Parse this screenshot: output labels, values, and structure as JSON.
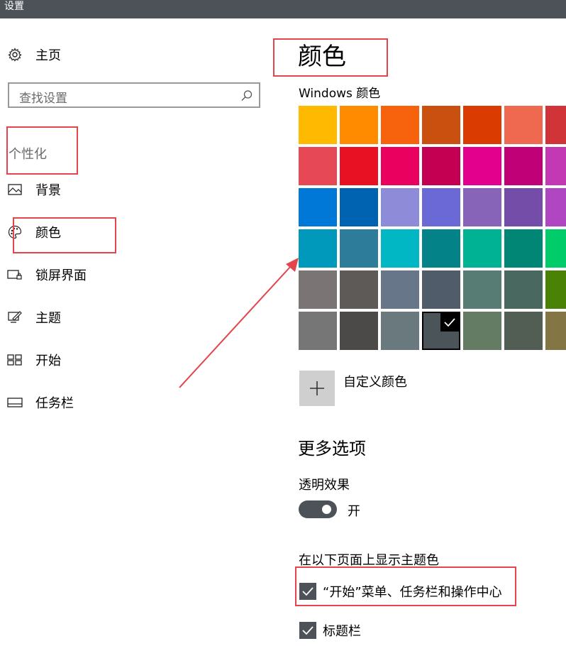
{
  "window": {
    "title": "设置"
  },
  "sidebar": {
    "home": {
      "label": "主页",
      "icon": "gear-icon"
    },
    "search": {
      "placeholder": "查找设置",
      "icon": "search-icon"
    },
    "category": "个性化",
    "items": [
      {
        "label": "背景",
        "icon": "picture-icon"
      },
      {
        "label": "颜色",
        "icon": "palette-icon"
      },
      {
        "label": "锁屏界面",
        "icon": "lock-screen-icon"
      },
      {
        "label": "主题",
        "icon": "theme-icon"
      },
      {
        "label": "开始",
        "icon": "start-icon"
      },
      {
        "label": "任务栏",
        "icon": "taskbar-icon"
      }
    ]
  },
  "main": {
    "title": "颜色",
    "windows_colors_label": "Windows 颜色",
    "swatches": [
      [
        "#ffb900",
        "#ff8c00",
        "#f7630c",
        "#ca5010",
        "#da3b01",
        "#ef6950",
        "#d13438"
      ],
      [
        "#e74856",
        "#e81123",
        "#ea005e",
        "#c30052",
        "#e3008c",
        "#bf0077",
        "#c239b3"
      ],
      [
        "#0078d7",
        "#0063b1",
        "#8e8cd8",
        "#6b69d6",
        "#8764b8",
        "#744da9",
        "#b146c2"
      ],
      [
        "#0099bc",
        "#2d7d9a",
        "#00b7c3",
        "#038387",
        "#00b294",
        "#018574",
        "#00cc6a"
      ],
      [
        "#7a7574",
        "#5d5a58",
        "#68768a",
        "#515c6b",
        "#567c73",
        "#486860",
        "#498205"
      ],
      [
        "#767676",
        "#4c4a48",
        "#69797e",
        "#4a5459",
        "#647c64",
        "#525e54",
        "#847545"
      ]
    ],
    "selected_swatch": "#4a5459",
    "custom_color_label": "自定义颜色",
    "more_options_heading": "更多选项",
    "transparency": {
      "label": "透明效果",
      "state": "开"
    },
    "show_accent_label": "在以下页面上显示主题色",
    "checkboxes": [
      {
        "label": "“开始”菜单、任务栏和操作中心",
        "checked": true
      },
      {
        "label": "标题栏",
        "checked": true
      }
    ]
  },
  "colors": {
    "annotation_red": "#e4454d",
    "control_dark": "#4c5258"
  }
}
